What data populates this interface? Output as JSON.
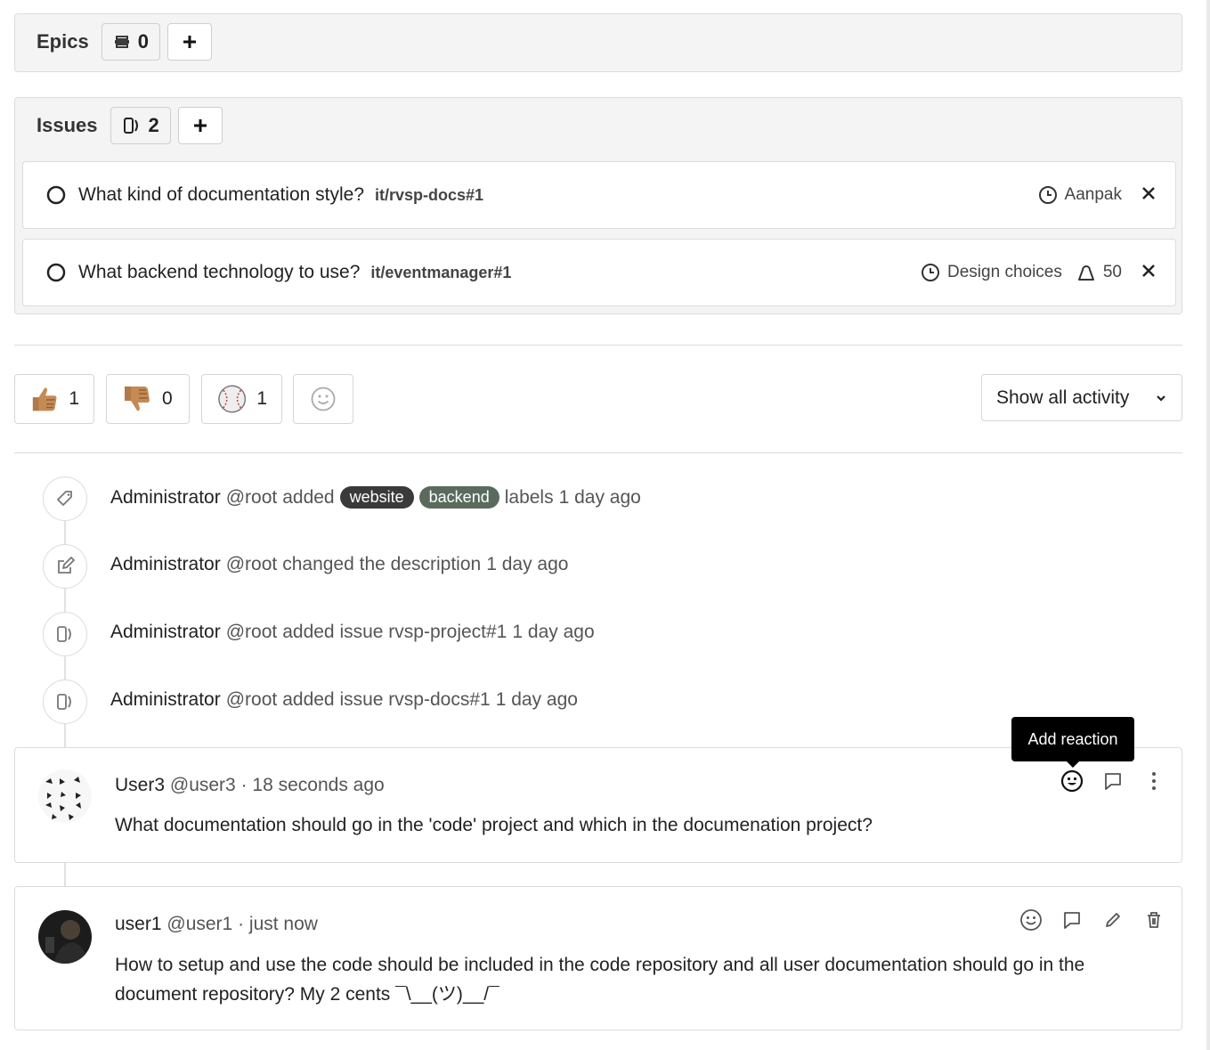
{
  "epics": {
    "title": "Epics",
    "count": "0",
    "icon": "epic-icon"
  },
  "issues": {
    "title": "Issues",
    "count": "2",
    "icon": "issues-icon",
    "items": [
      {
        "title": "What kind of documentation style?",
        "ref": "it/rvsp-docs#1",
        "milestone": "Aanpak",
        "weight": ""
      },
      {
        "title": "What backend technology to use?",
        "ref": "it/eventmanager#1",
        "milestone": "Design choices",
        "weight": "50"
      }
    ]
  },
  "awards": [
    {
      "emoji": "thumbs-up",
      "count": "1"
    },
    {
      "emoji": "thumbs-down",
      "count": "0"
    },
    {
      "emoji": "baseball",
      "count": "1"
    }
  ],
  "activity_filter": {
    "label": "Show all activity"
  },
  "events": [
    {
      "icon": "label-icon",
      "author": "Administrator",
      "handle": "@root",
      "action": "added",
      "labels": [
        "website",
        "backend"
      ],
      "suffix": "labels",
      "time": "1 day ago"
    },
    {
      "icon": "pencil-square-icon",
      "author": "Administrator",
      "handle": "@root",
      "action": "changed the description",
      "time": "1 day ago"
    },
    {
      "icon": "issues-icon",
      "author": "Administrator",
      "handle": "@root",
      "action": "added issue rvsp-project#1",
      "time": "1 day ago"
    },
    {
      "icon": "issues-icon",
      "author": "Administrator",
      "handle": "@root",
      "action": "added issue rvsp-docs#1",
      "time": "1 day ago"
    }
  ],
  "label_colors": {
    "website": "#3a3a3a",
    "backend": "#5a6b5e"
  },
  "tooltip": {
    "text": "Add reaction"
  },
  "notes": [
    {
      "author": "User3",
      "handle": "@user3",
      "sep": "·",
      "time": "18 seconds ago",
      "body": "What documentation should go in the 'code' project and which in the documenation project?"
    },
    {
      "author": "user1",
      "handle": "@user1",
      "sep": "·",
      "time": "just now",
      "body": "How to setup and use the code should be included in the code repository and all user documentation should go in the document repository? My 2 cents ¯\\__(ツ)__/¯"
    }
  ]
}
